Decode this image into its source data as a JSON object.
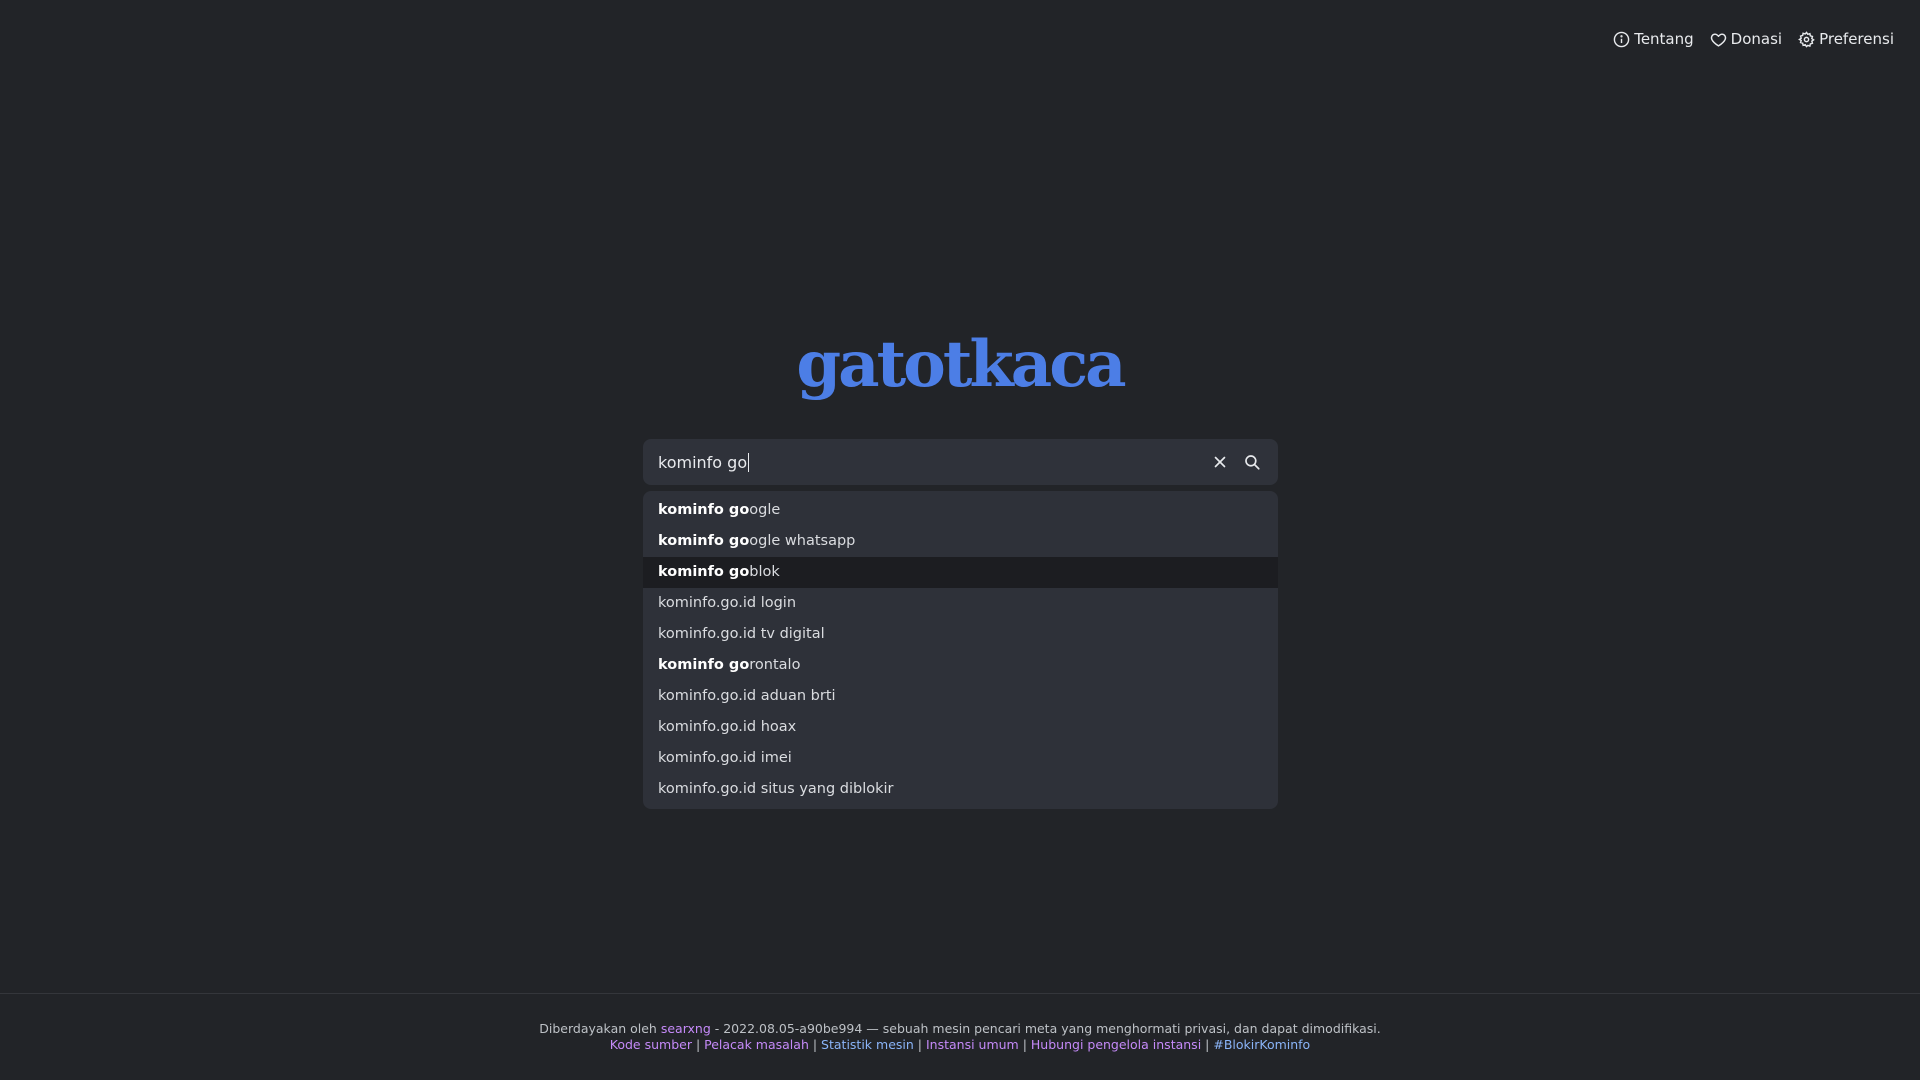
{
  "nav": {
    "about_label": "Tentang",
    "donate_label": "Donasi",
    "preferences_label": "Preferensi"
  },
  "logo": {
    "text": "gatotkaca"
  },
  "search": {
    "query": "kominfo go"
  },
  "suggestions": [
    {
      "bold": "kominfo go",
      "rest": "ogle"
    },
    {
      "bold": "kominfo go",
      "rest": "ogle whatsapp"
    },
    {
      "bold": "kominfo go",
      "rest": "blok"
    },
    {
      "bold": "",
      "rest": "kominfo.go.id login"
    },
    {
      "bold": "",
      "rest": "kominfo.go.id tv digital"
    },
    {
      "bold": "kominfo go",
      "rest": "rontalo"
    },
    {
      "bold": "",
      "rest": "kominfo.go.id aduan brti"
    },
    {
      "bold": "",
      "rest": "kominfo.go.id hoax"
    },
    {
      "bold": "",
      "rest": "kominfo.go.id imei"
    },
    {
      "bold": "",
      "rest": "kominfo.go.id situs yang diblokir"
    }
  ],
  "footer": {
    "powered_prefix": "Diberdayakan oleh ",
    "powered_link": "searxng",
    "powered_suffix": " - 2022.08.05-a90be994 — sebuah mesin pencari meta yang menghormati privasi, dan dapat dimodifikasi.",
    "sep": " | ",
    "links": {
      "source": "Kode sumber",
      "issues": "Pelacak masalah",
      "stats": "Statistik mesin",
      "instances": "Instansi umum",
      "contact": "Hubungi pengelola instansi",
      "hashtag": "#BlokirKominfo"
    }
  },
  "colors": {
    "background": "#222428",
    "logo": "#4c7ee6",
    "link_visited": "#c58af9",
    "link": "#8ab4f8"
  }
}
